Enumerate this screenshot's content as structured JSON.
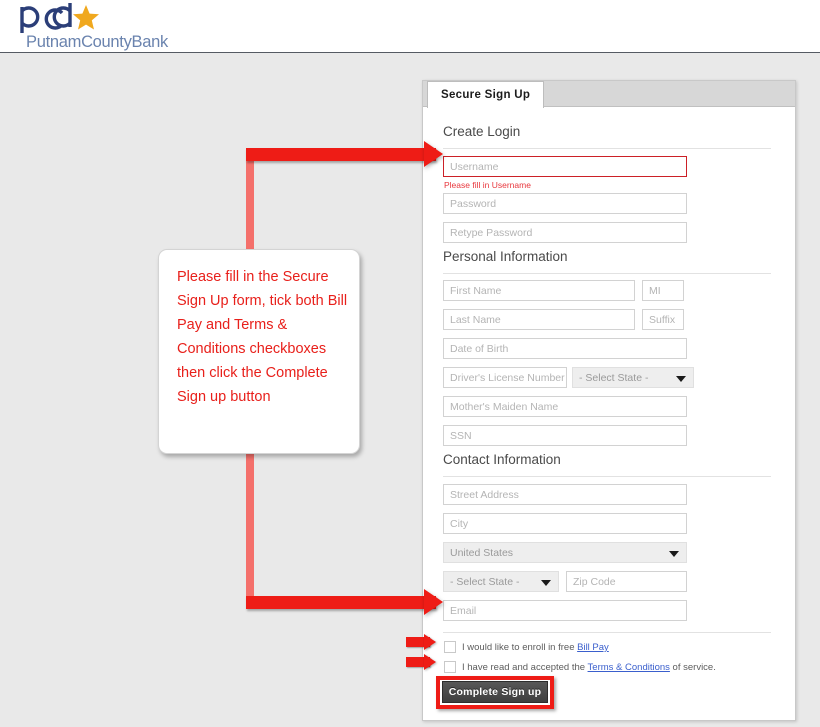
{
  "brand": {
    "mark_text": "pcb",
    "wordmark": "PutnamCountyBank",
    "mark_color": "#2b3e78",
    "star_color": "#f0a81e",
    "wordmark_color": "#6a83ae"
  },
  "panel": {
    "tabs": [
      {
        "label": "Secure Sign Up",
        "active": true
      }
    ],
    "sections": [
      {
        "id": "create-login",
        "title": "Create Login"
      },
      {
        "id": "personal-information",
        "title": "Personal Information"
      },
      {
        "id": "contact-information",
        "title": "Contact Information"
      }
    ],
    "fields": {
      "username": {
        "placeholder": "Username",
        "value": "",
        "error": "Please fill in Username",
        "invalid": true
      },
      "password": {
        "placeholder": "Password",
        "value": ""
      },
      "retype_password": {
        "placeholder": "Retype Password",
        "value": ""
      },
      "first_name": {
        "placeholder": "First Name",
        "value": ""
      },
      "mi": {
        "placeholder": "MI",
        "value": ""
      },
      "last_name": {
        "placeholder": "Last Name",
        "value": ""
      },
      "suffix": {
        "placeholder": "Suffix",
        "value": ""
      },
      "date_of_birth": {
        "placeholder": "Date of Birth",
        "value": ""
      },
      "drivers_license": {
        "placeholder": "Driver's License Number",
        "value": ""
      },
      "license_state": {
        "selected": "- Select State -"
      },
      "mothers_maiden_name": {
        "placeholder": "Mother's Maiden Name",
        "value": ""
      },
      "ssn": {
        "placeholder": "SSN",
        "value": ""
      },
      "street_address": {
        "placeholder": "Street Address",
        "value": ""
      },
      "city": {
        "placeholder": "City",
        "value": ""
      },
      "country": {
        "selected": "United States"
      },
      "state": {
        "selected": "- Select State -"
      },
      "zip_code": {
        "placeholder": "Zip Code",
        "value": ""
      },
      "email": {
        "placeholder": "Email",
        "value": ""
      }
    },
    "checkboxes": {
      "bill_pay": {
        "checked": false,
        "text_before": "I would like to enroll in free ",
        "link": "Bill Pay",
        "text_after": ""
      },
      "terms": {
        "checked": false,
        "text_before": "I have read and accepted the ",
        "link": "Terms & Conditions",
        "text_after": " of service."
      }
    },
    "submit": {
      "label": "Complete Sign up"
    }
  },
  "annotation": {
    "callout_text": "Please fill in the Secure Sign Up form, tick both Bill Pay and Terms & Conditions checkboxes then click the Complete Sign up button",
    "accent_color": "#ee1c16",
    "connector_color": "#f4706b"
  }
}
